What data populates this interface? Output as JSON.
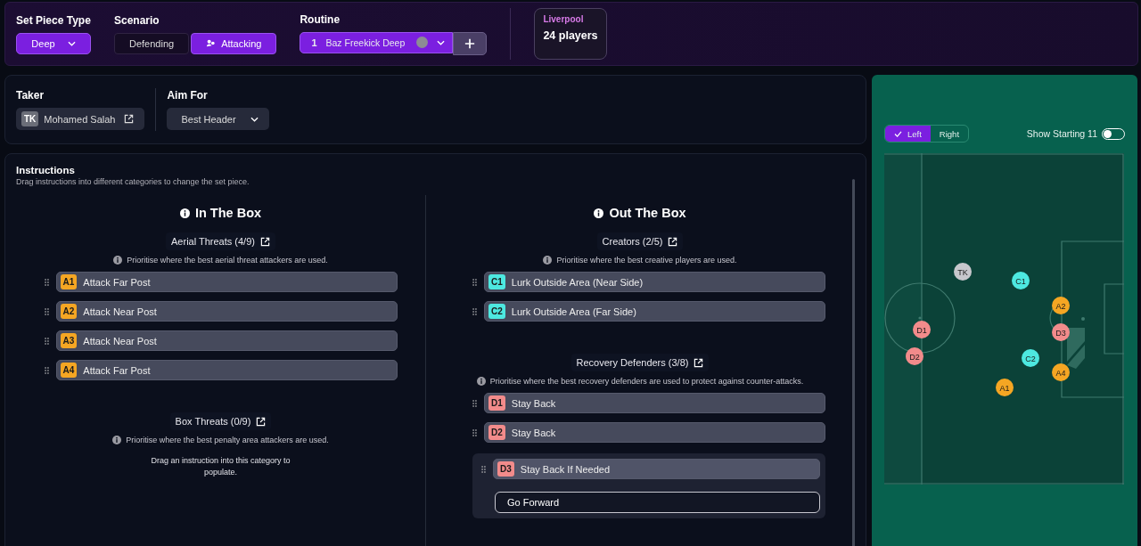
{
  "top_bar": {
    "set_piece_type": {
      "label": "Set Piece Type",
      "value": "Deep"
    },
    "scenario": {
      "label": "Scenario",
      "options": [
        {
          "label": "Defending",
          "selected": false
        },
        {
          "label": "Attacking",
          "selected": true
        }
      ]
    },
    "routine": {
      "label": "Routine",
      "number": "1",
      "name": "Baz Freekick Deep"
    },
    "team": {
      "name": "Liverpool",
      "players": "24 players"
    }
  },
  "taker": {
    "label": "Taker",
    "initials": "TK",
    "name": "Mohamed Salah"
  },
  "aim_for": {
    "label": "Aim For",
    "value": "Best Header"
  },
  "instructions": {
    "title": "Instructions",
    "subtitle": "Drag instructions into different categories to change the set piece.",
    "columns": [
      {
        "title": "In The Box",
        "groups": [
          {
            "title": "Aerial Threats (4/9)",
            "hint": "Prioritise where the best aerial threat attackers are used.",
            "rows": [
              {
                "badge": "A1",
                "text": "Attack Far Post",
                "color": "#f5a623",
                "expanded": false
              },
              {
                "badge": "A2",
                "text": "Attack Near Post",
                "color": "#f5a623",
                "expanded": false
              },
              {
                "badge": "A3",
                "text": "Attack Near Post",
                "color": "#f5a623",
                "expanded": false
              },
              {
                "badge": "A4",
                "text": "Attack Far Post",
                "color": "#f5a623",
                "expanded": false
              }
            ]
          },
          {
            "title": "Box Threats (0/9)",
            "hint": "Prioritise where the best penalty area attackers are used.",
            "empty": "Drag an instruction into this category to populate."
          }
        ]
      },
      {
        "title": "Out The Box",
        "groups": [
          {
            "title": "Creators (2/5)",
            "hint": "Prioritise where the best creative players are used.",
            "rows": [
              {
                "badge": "C1",
                "text": "Lurk Outside Area (Near Side)",
                "color": "#4de8e0",
                "expanded": false
              },
              {
                "badge": "C2",
                "text": "Lurk Outside Area (Far Side)",
                "color": "#4de8e0",
                "expanded": false
              }
            ]
          },
          {
            "title": "Recovery Defenders (3/8)",
            "hint": "Prioritise where the best recovery defenders are used to protect against counter-attacks.",
            "rows": [
              {
                "badge": "D1",
                "text": "Stay Back",
                "color": "#f28b8b",
                "expanded": false
              },
              {
                "badge": "D2",
                "text": "Stay Back",
                "color": "#f28b8b",
                "expanded": false
              },
              {
                "badge": "D3",
                "text": "Stay Back If Needed",
                "color": "#f28b8b",
                "expanded": true,
                "options": [
                  "Go Forward"
                ]
              }
            ]
          }
        ]
      }
    ]
  },
  "pitch_panel": {
    "side": [
      {
        "label": "Left",
        "selected": true
      },
      {
        "label": "Right",
        "selected": false
      }
    ],
    "show_starting": {
      "label": "Show Starting 11",
      "on": false
    },
    "markers": [
      {
        "label": "TK",
        "color": "#c7c7cc"
      },
      {
        "label": "C1",
        "color": "#4de8e0"
      },
      {
        "label": "A2",
        "color": "#f5a623"
      },
      {
        "label": "D3",
        "color": "#f28b8b"
      },
      {
        "label": "D1",
        "color": "#f28b8b"
      },
      {
        "label": "D2",
        "color": "#f28b8b"
      },
      {
        "label": "C2",
        "color": "#4de8e0"
      },
      {
        "label": "A4",
        "color": "#f5a623"
      },
      {
        "label": "A1",
        "color": "#f5a623"
      }
    ]
  }
}
